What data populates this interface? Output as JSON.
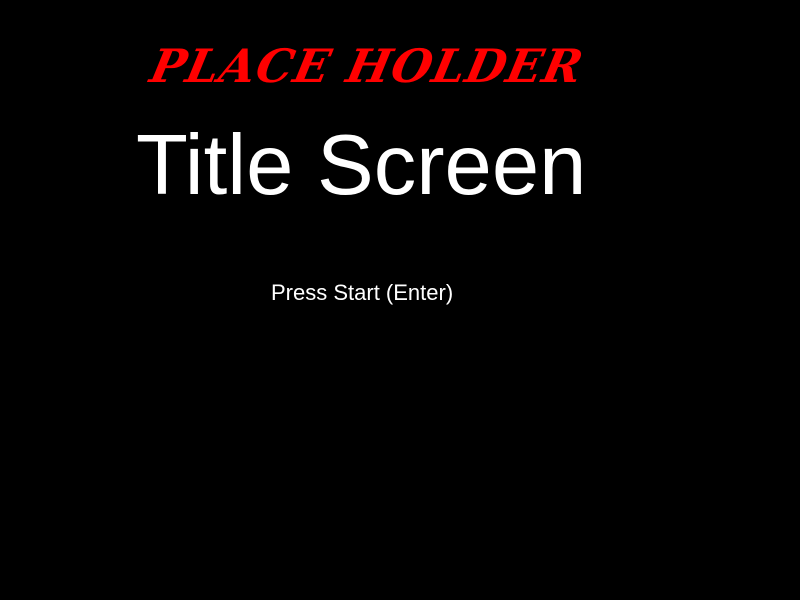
{
  "colors": {
    "background": "#000000",
    "banner": "#ff0000",
    "text": "#ffffff"
  },
  "banner": {
    "text": "PLACE HOLDER"
  },
  "title": {
    "text": "Title Screen"
  },
  "prompt": {
    "text": "Press Start (Enter)"
  }
}
